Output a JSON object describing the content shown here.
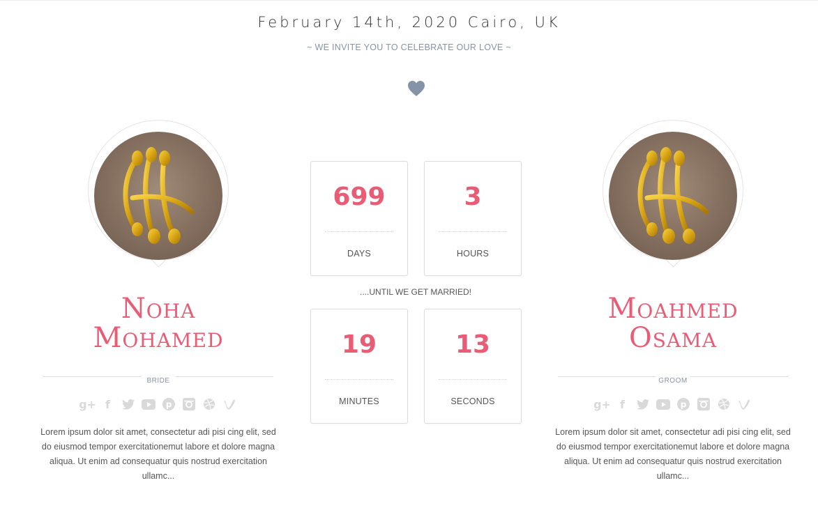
{
  "header": {
    "date_location": "February 14th, 2020 Cairo, UK",
    "invite_text": "~ WE INVITE YOU TO CELEBRATE OUR LOVE ~",
    "heart_icon": "heart-icon"
  },
  "colors": {
    "accent": "#e85d75",
    "muted": "#8593a6",
    "icon_gray": "#d9d9d9"
  },
  "bride": {
    "name_line1": "Noha",
    "name_line2": "Mohamed",
    "role": "BRIDE",
    "bio": "Lorem ipsum dolor sit amet, consectetur adi pisi cing elit, sed do eiusmod tempor exercitationemut labore et dolore magna aliqua. Ut enim ad consequatur quis nostrud exercitation ullamc..."
  },
  "groom": {
    "name_line1": "Moahmed",
    "name_line2": "Osama",
    "role": "GROOM",
    "bio": "Lorem ipsum dolor sit amet, consectetur adi pisi cing elit, sed do eiusmod tempor exercitationemut labore et dolore magna aliqua. Ut enim ad consequatur quis nostrud exercitation ullamc..."
  },
  "social_icons": [
    "google-plus-icon",
    "facebook-icon",
    "twitter-icon",
    "youtube-icon",
    "pinterest-icon",
    "instagram-icon",
    "dribbble-icon",
    "vimeo-icon"
  ],
  "countdown": {
    "days": {
      "value": "699",
      "label": "DAYS"
    },
    "hours": {
      "value": "3",
      "label": "HOURS"
    },
    "minutes": {
      "value": "19",
      "label": "MINUTES"
    },
    "seconds": {
      "value": "13",
      "label": "SECONDS"
    },
    "until_text": "....UNTIL WE GET MARRIED!"
  }
}
